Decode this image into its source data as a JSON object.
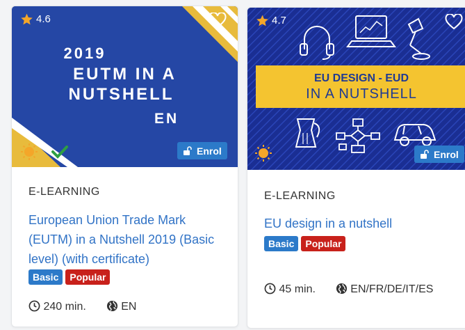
{
  "cards": [
    {
      "rating": "4.6",
      "banner": {
        "year": "2019",
        "line1": "EUTM IN A",
        "line2": "NUTSHELL",
        "lang": "EN",
        "bg_color": "#2547a5",
        "accent_color": "#e8bb3c"
      },
      "enrol_label": "Enrol",
      "category": "E-LEARNING",
      "title": "European Union Trade Mark (EUTM) in a Nutshell 2019 (Basic level) (with certificate)",
      "badges": [
        "Basic",
        "Popular"
      ],
      "duration": "240 min.",
      "languages": "EN"
    },
    {
      "rating": "4.7",
      "banner": {
        "line1": "EU DESIGN - EUD",
        "line2": "IN A NUTSHELL",
        "bg_color": "#1a2e93",
        "band_color": "#f4c430"
      },
      "enrol_label": "Enrol",
      "category": "E-LEARNING",
      "title": "EU design in a nutshell",
      "badges": [
        "Basic",
        "Popular"
      ],
      "duration": "45 min.",
      "languages": "EN/FR/DE/IT/ES"
    }
  ],
  "colors": {
    "link": "#3173c6",
    "basic_badge": "#2c7ac9",
    "popular_badge": "#c8211b",
    "star": "#f4a629"
  },
  "icons": [
    "star-icon",
    "heart-icon",
    "unlock-icon",
    "clock-icon",
    "globe-icon",
    "sun-icon",
    "check-icon",
    "headphones-icon",
    "laptop-icon",
    "lamp-icon",
    "coffee-pot-icon",
    "flowchart-icon",
    "car-icon"
  ]
}
